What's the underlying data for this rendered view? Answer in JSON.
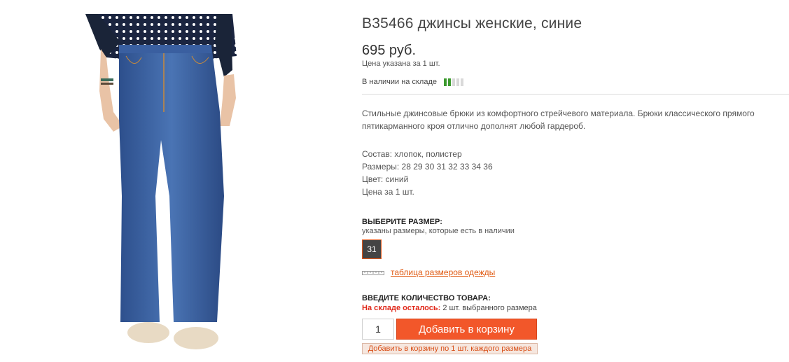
{
  "product": {
    "title": "B35466 джинсы женские, синие",
    "price": "695 руб.",
    "price_note": "Цена указана за 1 шт.",
    "stock_text": "В наличии на складе",
    "stock_level": 0.4,
    "description": "Стильные джинсовые брюки из комфортного стрейчевого материала. Брюки классического прямого пятикарманного кроя отлично дополнят любой гардероб.",
    "specs": [
      "Состав:  хлопок, полистер",
      "Размеры: 28 29 30 31 32 33 34 36",
      "Цвет: синий",
      "Цена за 1 шт."
    ]
  },
  "size": {
    "title": "ВЫБЕРИТЕ РАЗМЕР:",
    "note": "указаны размеры, которые есть в наличии",
    "selected": "31",
    "table_link": "таблица размеров одежды"
  },
  "quantity": {
    "title": "ВВЕДИТЕ КОЛИЧЕСТВО ТОВАРА:",
    "stock_label": "На складе осталось:",
    "stock_value": "2 шт. выбранного размера",
    "value": "1",
    "add_button": "Добавить в корзину",
    "add_all_button": "Добавить в корзину по 1 шт. каждого размера"
  },
  "colors": {
    "accent": "#f2572a",
    "link": "#e05a12",
    "stock_green": "#3c9a2e",
    "alert_red": "#e0281a"
  },
  "icons": {
    "ruler": "ruler-icon",
    "stock": "stock-level-icon"
  }
}
